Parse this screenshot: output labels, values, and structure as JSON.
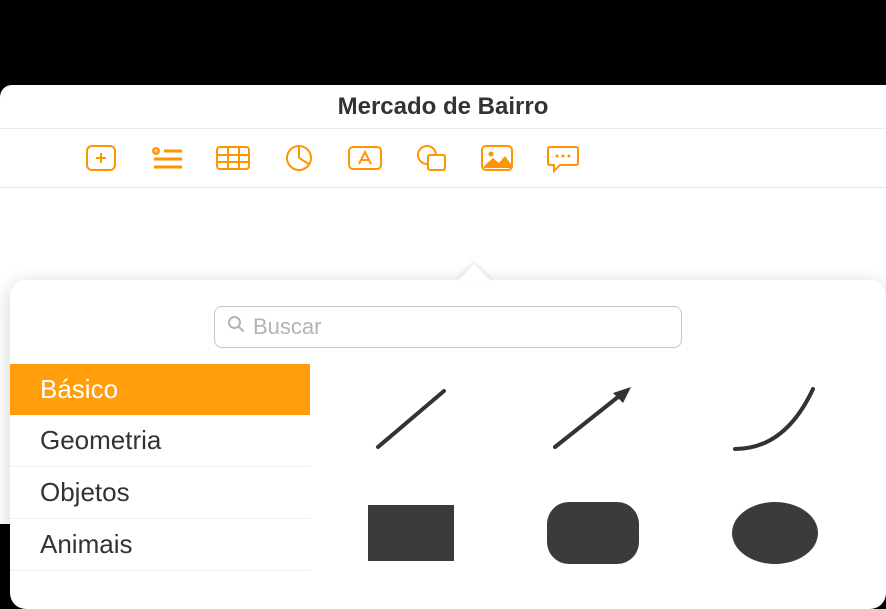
{
  "header": {
    "title": "Mercado de Bairro"
  },
  "toolbar": {
    "buttons": [
      "add",
      "list",
      "table",
      "chart",
      "textbox",
      "shape",
      "image",
      "comment"
    ]
  },
  "popover": {
    "search_placeholder": "Buscar",
    "categories": [
      {
        "label": "Básico",
        "selected": true
      },
      {
        "label": "Geometria",
        "selected": false
      },
      {
        "label": "Objetos",
        "selected": false
      },
      {
        "label": "Animais",
        "selected": false
      }
    ],
    "shapes_row1": [
      "line",
      "arrow",
      "curve"
    ],
    "shapes_row2": [
      "square",
      "rounded-square",
      "circle"
    ]
  },
  "colors": {
    "accent": "#ff9500",
    "selection": "#ff9e0a",
    "shape_fill": "#3b3b3b"
  }
}
